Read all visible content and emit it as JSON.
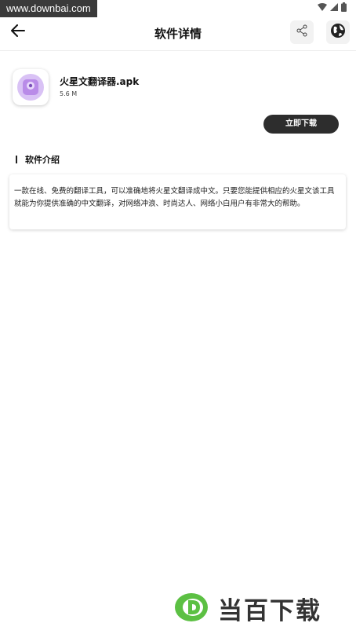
{
  "watermark": {
    "text": "www.downbai.com"
  },
  "header": {
    "title": "软件详情"
  },
  "app": {
    "name": "火星文翻译器.apk",
    "size": "5.6 M"
  },
  "actions": {
    "download_label": "立即下载"
  },
  "section": {
    "title": "软件介绍"
  },
  "description": {
    "text": "一款在线、免费的翻译工具，可以准确地将火星文翻译成中文。只要您能提供相应的火星文该工具就能为你提供准确的中文翻译，对网络冲浪、时尚达人、网络小白用户有非常大的帮助。"
  },
  "brand": {
    "text": "当百下载"
  },
  "icons": {
    "back": "arrow-left-icon",
    "share": "share-icon",
    "globe": "globe-icon",
    "wifi": "wifi-icon",
    "signal": "signal-icon",
    "battery": "battery-icon"
  },
  "colors": {
    "button_bg": "#2d2d2d",
    "brand_green": "#5cc043",
    "app_icon_purple": "#b98be8"
  }
}
